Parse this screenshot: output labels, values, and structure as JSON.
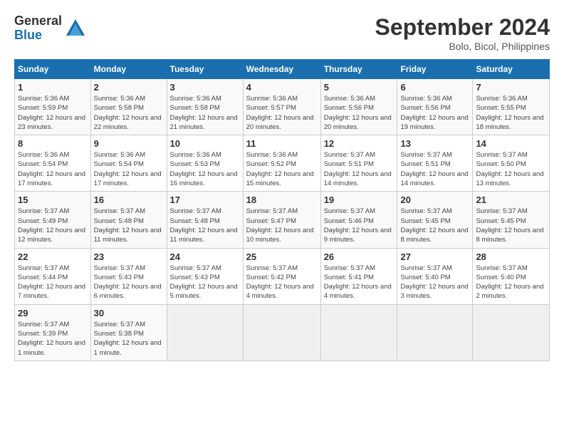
{
  "header": {
    "logo_general": "General",
    "logo_blue": "Blue",
    "month_title": "September 2024",
    "location": "Bolo, Bicol, Philippines"
  },
  "calendar": {
    "days_of_week": [
      "Sunday",
      "Monday",
      "Tuesday",
      "Wednesday",
      "Thursday",
      "Friday",
      "Saturday"
    ],
    "weeks": [
      [
        null,
        {
          "day": 2,
          "sunrise": "5:36 AM",
          "sunset": "5:58 PM",
          "daylight": "12 hours and 22 minutes."
        },
        {
          "day": 3,
          "sunrise": "5:36 AM",
          "sunset": "5:58 PM",
          "daylight": "12 hours and 21 minutes."
        },
        {
          "day": 4,
          "sunrise": "5:36 AM",
          "sunset": "5:57 PM",
          "daylight": "12 hours and 20 minutes."
        },
        {
          "day": 5,
          "sunrise": "5:36 AM",
          "sunset": "5:56 PM",
          "daylight": "12 hours and 20 minutes."
        },
        {
          "day": 6,
          "sunrise": "5:36 AM",
          "sunset": "5:56 PM",
          "daylight": "12 hours and 19 minutes."
        },
        {
          "day": 7,
          "sunrise": "5:36 AM",
          "sunset": "5:55 PM",
          "daylight": "12 hours and 18 minutes."
        }
      ],
      [
        {
          "day": 1,
          "sunrise": "5:36 AM",
          "sunset": "5:59 PM",
          "daylight": "12 hours and 23 minutes."
        },
        null,
        null,
        null,
        null,
        null,
        null
      ],
      [
        {
          "day": 8,
          "sunrise": "5:36 AM",
          "sunset": "5:54 PM",
          "daylight": "12 hours and 17 minutes."
        },
        {
          "day": 9,
          "sunrise": "5:36 AM",
          "sunset": "5:54 PM",
          "daylight": "12 hours and 17 minutes."
        },
        {
          "day": 10,
          "sunrise": "5:36 AM",
          "sunset": "5:53 PM",
          "daylight": "12 hours and 16 minutes."
        },
        {
          "day": 11,
          "sunrise": "5:36 AM",
          "sunset": "5:52 PM",
          "daylight": "12 hours and 15 minutes."
        },
        {
          "day": 12,
          "sunrise": "5:37 AM",
          "sunset": "5:51 PM",
          "daylight": "12 hours and 14 minutes."
        },
        {
          "day": 13,
          "sunrise": "5:37 AM",
          "sunset": "5:51 PM",
          "daylight": "12 hours and 14 minutes."
        },
        {
          "day": 14,
          "sunrise": "5:37 AM",
          "sunset": "5:50 PM",
          "daylight": "12 hours and 13 minutes."
        }
      ],
      [
        {
          "day": 15,
          "sunrise": "5:37 AM",
          "sunset": "5:49 PM",
          "daylight": "12 hours and 12 minutes."
        },
        {
          "day": 16,
          "sunrise": "5:37 AM",
          "sunset": "5:48 PM",
          "daylight": "12 hours and 11 minutes."
        },
        {
          "day": 17,
          "sunrise": "5:37 AM",
          "sunset": "5:48 PM",
          "daylight": "12 hours and 11 minutes."
        },
        {
          "day": 18,
          "sunrise": "5:37 AM",
          "sunset": "5:47 PM",
          "daylight": "12 hours and 10 minutes."
        },
        {
          "day": 19,
          "sunrise": "5:37 AM",
          "sunset": "5:46 PM",
          "daylight": "12 hours and 9 minutes."
        },
        {
          "day": 20,
          "sunrise": "5:37 AM",
          "sunset": "5:45 PM",
          "daylight": "12 hours and 8 minutes."
        },
        {
          "day": 21,
          "sunrise": "5:37 AM",
          "sunset": "5:45 PM",
          "daylight": "12 hours and 8 minutes."
        }
      ],
      [
        {
          "day": 22,
          "sunrise": "5:37 AM",
          "sunset": "5:44 PM",
          "daylight": "12 hours and 7 minutes."
        },
        {
          "day": 23,
          "sunrise": "5:37 AM",
          "sunset": "5:43 PM",
          "daylight": "12 hours and 6 minutes."
        },
        {
          "day": 24,
          "sunrise": "5:37 AM",
          "sunset": "5:43 PM",
          "daylight": "12 hours and 5 minutes."
        },
        {
          "day": 25,
          "sunrise": "5:37 AM",
          "sunset": "5:42 PM",
          "daylight": "12 hours and 4 minutes."
        },
        {
          "day": 26,
          "sunrise": "5:37 AM",
          "sunset": "5:41 PM",
          "daylight": "12 hours and 4 minutes."
        },
        {
          "day": 27,
          "sunrise": "5:37 AM",
          "sunset": "5:40 PM",
          "daylight": "12 hours and 3 minutes."
        },
        {
          "day": 28,
          "sunrise": "5:37 AM",
          "sunset": "5:40 PM",
          "daylight": "12 hours and 2 minutes."
        }
      ],
      [
        {
          "day": 29,
          "sunrise": "5:37 AM",
          "sunset": "5:39 PM",
          "daylight": "12 hours and 1 minute."
        },
        {
          "day": 30,
          "sunrise": "5:37 AM",
          "sunset": "5:38 PM",
          "daylight": "12 hours and 1 minute."
        },
        null,
        null,
        null,
        null,
        null
      ]
    ]
  }
}
